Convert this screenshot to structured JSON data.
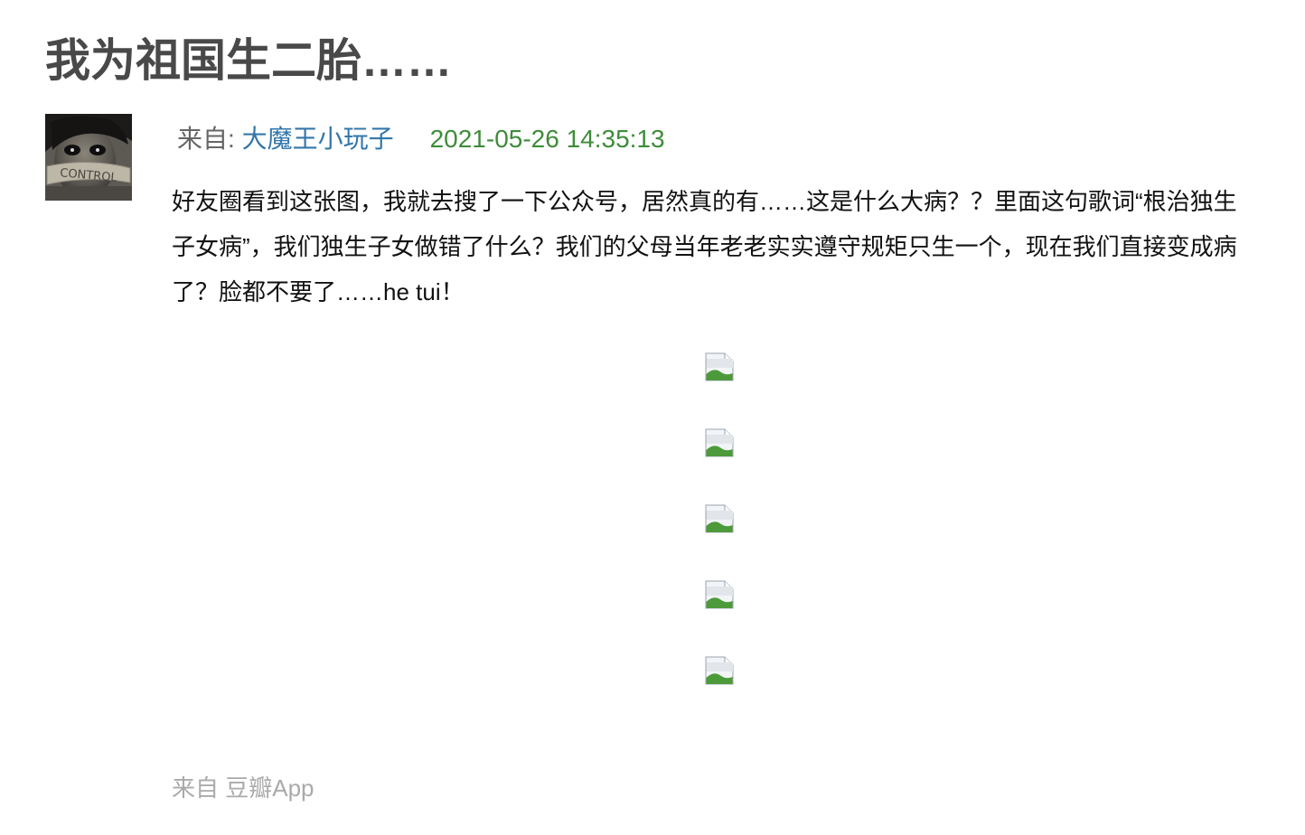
{
  "post": {
    "title": "我为祖国生二胎……",
    "from_label": "来自: ",
    "author": "大魔王小玩子",
    "timestamp": "2021-05-26 14:35:13",
    "content": "好友圈看到这张图，我就去搜了一下公众号，居然真的有……这是什么大病？？里面这句歌词“根治独生子女病”，我们独生子女做错了什么？我们的父母当年老老实实遵守规矩只生一个，现在我们直接变成病了？脸都不要了……he tui！",
    "avatar_text": "CONTROL",
    "images": [
      "broken-image-icon",
      "broken-image-icon",
      "broken-image-icon",
      "broken-image-icon",
      "broken-image-icon"
    ],
    "source_label": "来自 ",
    "source_app": "豆瓣App"
  }
}
